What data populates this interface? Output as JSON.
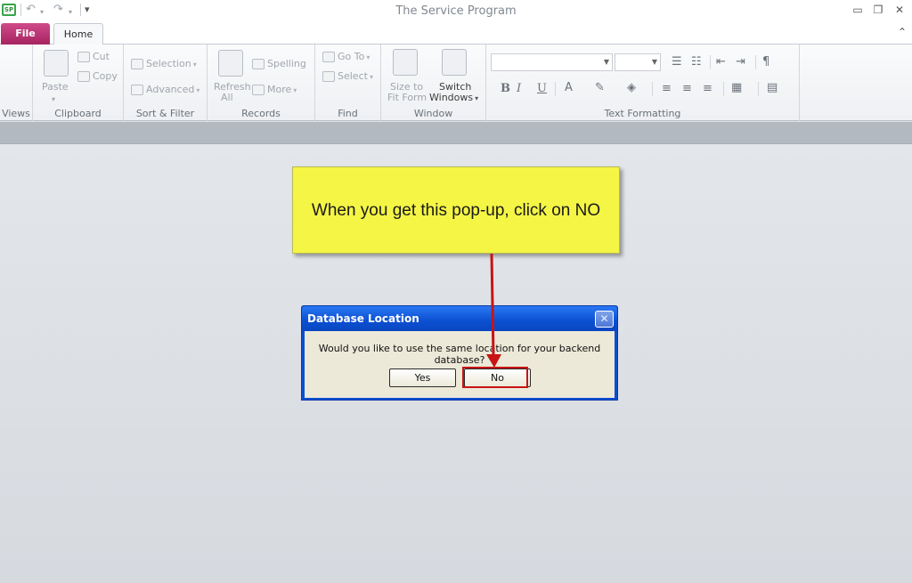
{
  "window": {
    "title": "The Service Program",
    "controls": {
      "minimize": "▭",
      "restore": "❐",
      "close": "✕"
    }
  },
  "quick_access": {
    "app_icon": "SP",
    "undo_icon": "undo-icon",
    "redo_icon": "redo-icon",
    "customize_icon": "customize-icon"
  },
  "tabs": [
    {
      "label": "File"
    },
    {
      "label": "Home"
    }
  ],
  "ribbon": {
    "groups": {
      "views": {
        "label": "Views"
      },
      "clipboard": {
        "label": "Clipboard",
        "paste": "Paste",
        "cut": "Cut",
        "copy": "Copy"
      },
      "sort_filter": {
        "label": "Sort & Filter",
        "selection": "Selection",
        "advanced": "Advanced"
      },
      "records": {
        "label": "Records",
        "refresh_line1": "Refresh",
        "refresh_line2": "All",
        "spelling": "Spelling",
        "more": "More"
      },
      "find": {
        "label": "Find",
        "goto": "Go To",
        "select": "Select"
      },
      "window": {
        "label": "Window",
        "size_line1": "Size to",
        "size_line2": "Fit Form",
        "switch_line1": "Switch",
        "switch_line2": "Windows"
      },
      "text_formatting": {
        "label": "Text Formatting",
        "bold": "B",
        "italic": "I",
        "underline": "U",
        "font_color": "A"
      }
    }
  },
  "callout": {
    "text": "When you get this pop-up, click on NO"
  },
  "dialog": {
    "title": "Database Location",
    "message": "Would you like to use the same location for your backend database?",
    "yes_label": "Yes",
    "no_label": "No",
    "close_glyph": "✕"
  },
  "colors": {
    "file_tab": "#b42d6e",
    "callout_bg": "#f5f545",
    "dialog_title": "#0a4fd0",
    "arrow": "#c81414"
  }
}
